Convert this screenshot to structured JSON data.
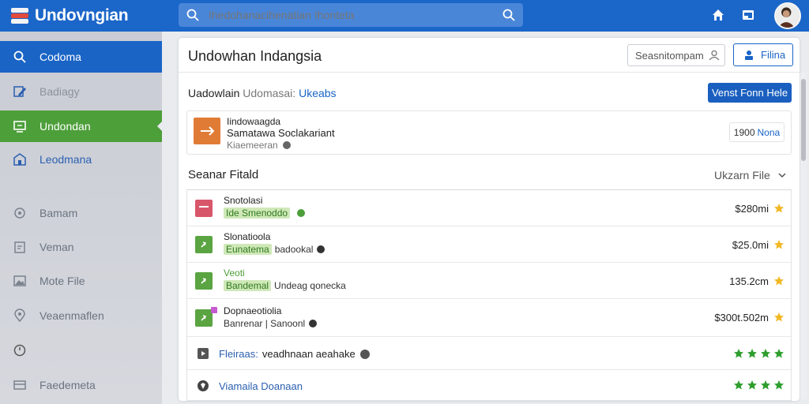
{
  "app": {
    "title": "Undovngian"
  },
  "search": {
    "placeholder": "Ihedohanacihenatian Ihonteta"
  },
  "sidebar": {
    "items": [
      {
        "label": "Codoma",
        "icon": "search-icon"
      },
      {
        "label": "Badiagy",
        "icon": "pencil-icon"
      },
      {
        "label": "Undondan",
        "icon": "monitor-icon"
      },
      {
        "label": "Leodmana",
        "icon": "building-icon"
      },
      {
        "label": "Bamam",
        "icon": "gear-icon"
      },
      {
        "label": "Veman",
        "icon": "clipboard-icon"
      },
      {
        "label": "Mote File",
        "icon": "image-icon"
      },
      {
        "label": "Veaenmaflen",
        "icon": "location-pin-icon"
      },
      {
        "label": "",
        "icon": "clock-icon"
      },
      {
        "label": "Faedemeta",
        "icon": "card-icon"
      }
    ]
  },
  "header": {
    "title": "Undowhan Indangsia",
    "search_label": "Seasnitompam",
    "button_label": "Filina"
  },
  "subheader": {
    "part1": "Uadowlain",
    "part2": "Udomasai:",
    "part3": "Ukeabs",
    "button_label": "Venst Fonn Hele"
  },
  "card": {
    "line1": "Iindowaagda",
    "line2": "Samatawa Soclakariant",
    "line3": "Kiaemeeran",
    "badge_value": "1900",
    "badge_link": "Nona"
  },
  "section": {
    "title": "Seanar Fitald",
    "filter_label": "Ukzarn File"
  },
  "list": {
    "rows": [
      {
        "name": "Snotolasi",
        "tag": "Ide Smenoddo",
        "meta": "",
        "price": "$280mi"
      },
      {
        "name": "Slonatioola",
        "tag": "Eunatema",
        "meta": "badookal",
        "price": "$25.0mi"
      },
      {
        "name": "Veoti",
        "tag": "Bandemal",
        "meta": "Undeag qonecka",
        "price": "135.2cm"
      },
      {
        "name": "Dopnaeotiolia",
        "tag": "",
        "meta": "Banrenar | Sanoonl",
        "price": "$300t.502m"
      }
    ],
    "links": [
      {
        "part1": "Fleiraas:",
        "part2": "veadhnaan aeahake"
      },
      {
        "part1": "Viamaila Doanaan",
        "part2": ""
      }
    ]
  },
  "colors": {
    "brand": "#1b66c9",
    "active_green": "#4d9f3a",
    "accent_orange": "#e07b35",
    "star_gold": "#f2b824",
    "star_green": "#2e9e2e"
  }
}
